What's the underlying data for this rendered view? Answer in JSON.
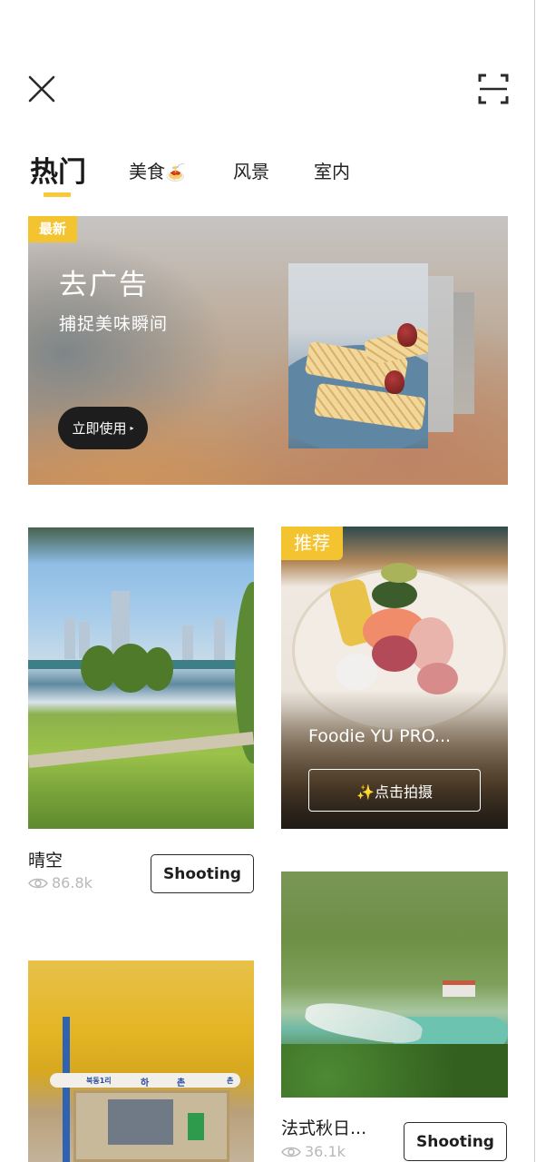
{
  "header": {
    "close_icon": "close-icon",
    "scan_icon": "scan-icon"
  },
  "tabs": [
    {
      "label": "热门",
      "active": true
    },
    {
      "label": "美食",
      "emoji": "🍝",
      "active": false
    },
    {
      "label": "风景",
      "active": false
    },
    {
      "label": "室内",
      "active": false
    }
  ],
  "accent_color": "#f4c430",
  "banner": {
    "badge": "最新",
    "title": "去广告",
    "subtitle": "捕捉美味瞬间",
    "button_label": "立即使用",
    "button_arrow": "▸"
  },
  "cards": [
    {
      "title": "晴空",
      "views": "86.8k",
      "button_label": "Shooting"
    },
    {
      "badge": "推荐",
      "title": "Foodie YU PRO...",
      "cta_label": "✨点击拍摄"
    },
    {
      "title": "",
      "shelter_text": [
        "북동1리",
        "하",
        "촌",
        "촌"
      ]
    },
    {
      "title": "法式秋日...",
      "views": "36.1k",
      "button_label": "Shooting"
    }
  ]
}
